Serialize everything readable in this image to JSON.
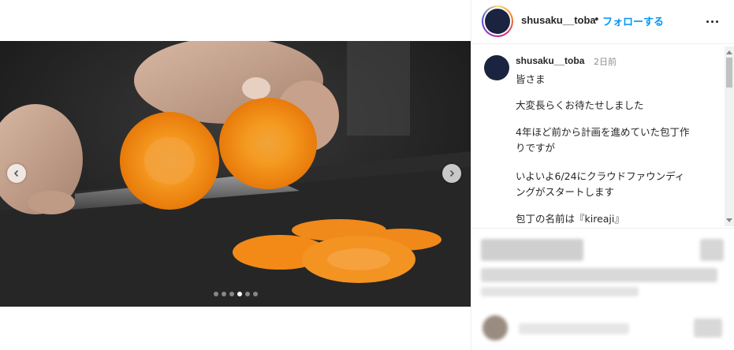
{
  "post": {
    "username": "shusaku__toba",
    "separator": "•",
    "follow_label": "フォローする",
    "timestamp": "2日前",
    "caption_lines": [
      "皆さま",
      "大変長らくお待たせしました",
      "4年ほど前から計画を進めていた包丁作",
      "りですが",
      "いよいよ6/24にクラウドファウンディ",
      "ングがスタートします",
      "包丁の名前は『kireaji』"
    ]
  },
  "carousel": {
    "slide_count": 6,
    "active_index": 3
  },
  "colors": {
    "accent": "#0095f6",
    "text": "#262626",
    "muted": "#8e8e8e",
    "avatar": "#1a2340"
  },
  "icons": {
    "prev": "chevron-left-icon",
    "next": "chevron-right-icon",
    "more": "more-horizontal-icon"
  }
}
